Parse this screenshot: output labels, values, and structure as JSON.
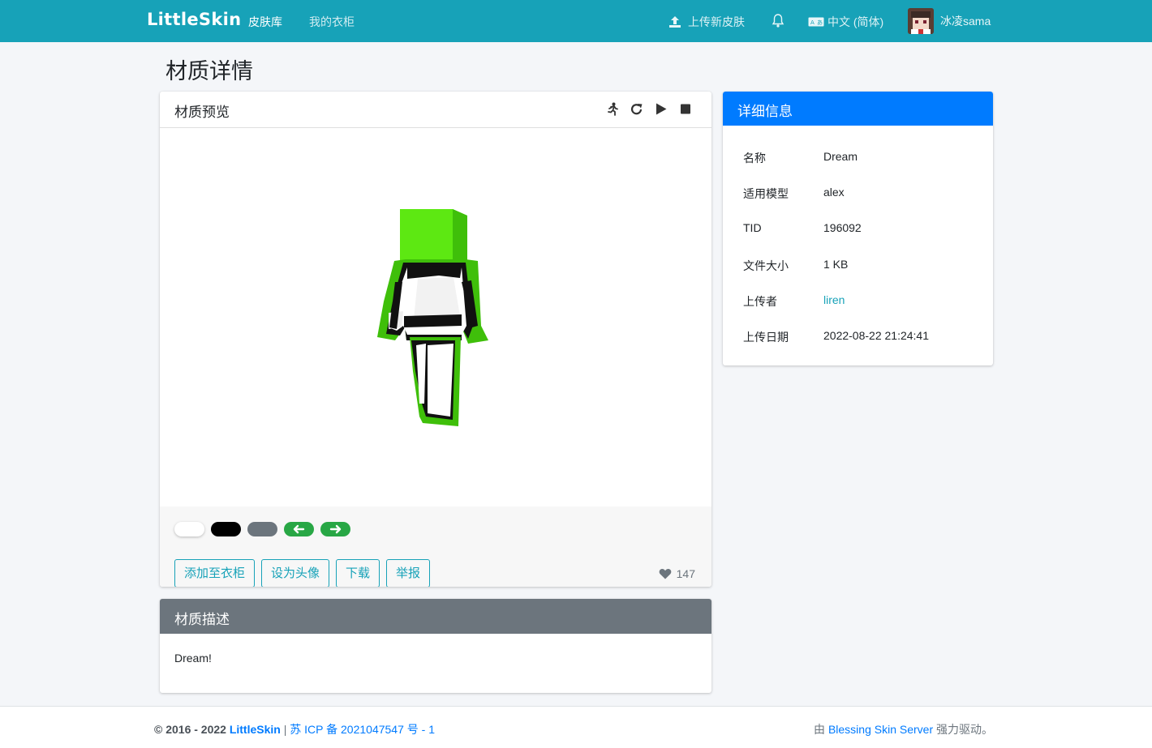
{
  "nav": {
    "brand": "LittleSkin",
    "skinlib": "皮肤库",
    "closet": "我的衣柜",
    "upload": "上传新皮肤",
    "language": "中文 (简体)",
    "username": "冰凌sama",
    "icons": [
      "upload-icon",
      "bell-icon",
      "language-icon",
      "avatar"
    ]
  },
  "page": {
    "title": "材质详情"
  },
  "preview": {
    "header": "材质预览",
    "tools": [
      "run-icon",
      "rotate-icon",
      "play-icon",
      "stop-icon"
    ],
    "swatches": [
      "white",
      "black",
      "gray",
      "prev",
      "next"
    ],
    "buttons": {
      "add_closet": "添加至衣柜",
      "set_avatar": "设为头像",
      "download": "下载",
      "report": "举报"
    },
    "likes": "147"
  },
  "description": {
    "header": "材质描述",
    "text": "Dream!"
  },
  "details": {
    "header": "详细信息",
    "rows": [
      {
        "key": "名称",
        "value": "Dream"
      },
      {
        "key": "适用模型",
        "value": "alex"
      },
      {
        "key": "TID",
        "value": "196092"
      },
      {
        "key": "文件大小",
        "value": "1 KB"
      },
      {
        "key": "上传者",
        "value": "liren"
      },
      {
        "key": "上传日期",
        "value": "2022-08-22 21:24:41"
      }
    ]
  },
  "footer": {
    "copyright": "© 2016 - 2022",
    "brand": "LittleSkin",
    "sep": "|",
    "icp": "苏 ICP 备 2021047547 号 - 1",
    "powered_prefix": "由",
    "powered_link": "Blessing Skin Server",
    "powered_suffix": "强力驱动。"
  },
  "colors": {
    "navbar": "#17a2b8",
    "info_header": "#007bff",
    "desc_header": "#6c757d",
    "skin_green": "#5de812",
    "action_green": "#28a745"
  }
}
